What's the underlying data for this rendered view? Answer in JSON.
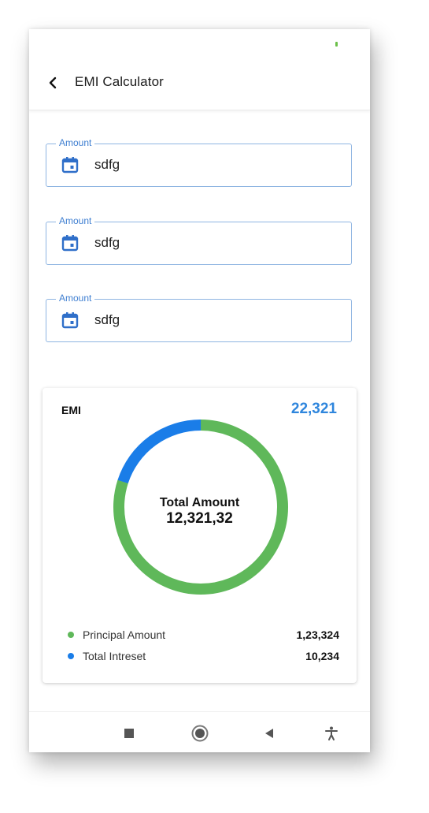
{
  "app": {
    "title": "EMI Calculator"
  },
  "form": {
    "fields": [
      {
        "label": "Amount",
        "value": "sdfg",
        "icon": "calendar-icon"
      },
      {
        "label": "Amount",
        "value": "sdfg",
        "icon": "calendar-icon"
      },
      {
        "label": "Amount",
        "value": "sdfg",
        "icon": "calendar-icon"
      }
    ]
  },
  "summary": {
    "emi_label": "EMI",
    "emi_value": "22,321",
    "center_title": "Total Amount",
    "center_value": "12,321,32",
    "legend": [
      {
        "name": "Principal Amount",
        "value": "1,23,324",
        "color": "#5fb85a"
      },
      {
        "name": "Total Intreset",
        "value": "10,234",
        "color": "#1a7de8"
      }
    ],
    "donut_fractions": {
      "principal": 0.8,
      "interest": 0.2
    }
  },
  "colors": {
    "accent": "#3f7fd1",
    "principal": "#5fb85a",
    "interest": "#1a7de8"
  },
  "nav": {
    "icons": [
      "recents-square-icon",
      "home-circle-icon",
      "back-triangle-icon",
      "accessibility-icon"
    ]
  }
}
